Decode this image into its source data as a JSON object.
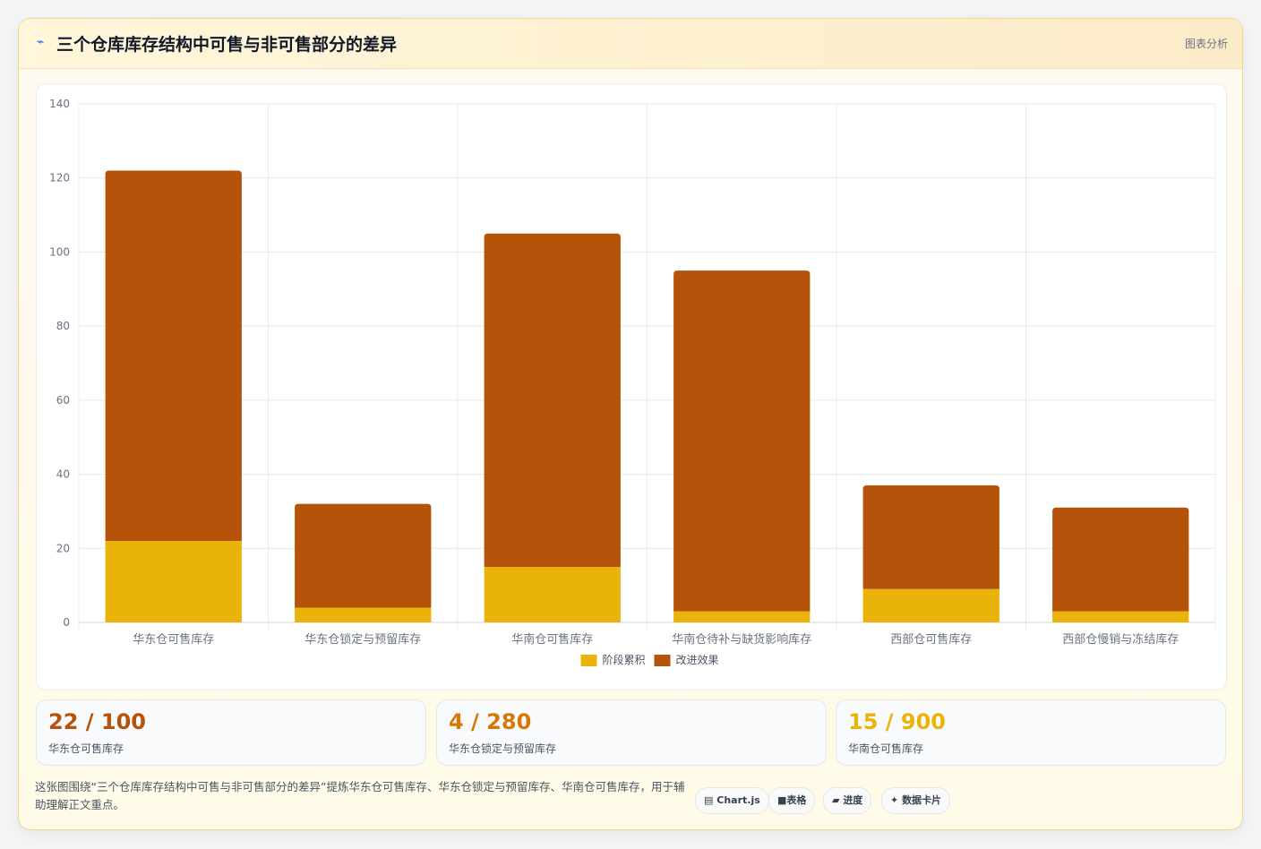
{
  "header": {
    "icon": "chart-icon",
    "title": "三个仓库库存结构中可售与非可售部分的差异",
    "tag": "图表分析"
  },
  "chart_data": {
    "type": "bar",
    "stacked": true,
    "categories": [
      "华东仓可售库存",
      "华东仓锁定与预留库存",
      "华南仓可售库存",
      "华南仓待补与缺货影响库存",
      "西部仓可售库存",
      "西部仓慢销与冻结库存"
    ],
    "series": [
      {
        "name": "阶段累积",
        "color": "#eab30a",
        "values": [
          22,
          4,
          15,
          3,
          9,
          3
        ]
      },
      {
        "name": "改进效果",
        "color": "#b45309",
        "values": [
          100,
          28,
          90,
          92,
          28,
          28
        ]
      }
    ],
    "ylim": [
      0,
      140
    ],
    "yticks": [
      0,
      20,
      40,
      60,
      80,
      100,
      120,
      140
    ],
    "grid": true,
    "legend_position": "bottom"
  },
  "stats": [
    {
      "value": "22 / 100",
      "label": "华东仓可售库存",
      "color": "#b45309"
    },
    {
      "value": "4 / 280",
      "label": "华东仓锁定与预留库存",
      "color": "#d97706"
    },
    {
      "value": "15 / 900",
      "label": "华南仓可售库存",
      "color": "#eab30a"
    }
  ],
  "footer": {
    "note": "这张图围绕“三个仓库库存结构中可售与非可售部分的差异”提炼华东仓可售库存、华东仓锁定与预留库存、华南仓可售库存，用于辅助理解正文重点。",
    "chips": [
      {
        "icon": "chart-icon",
        "glyph": "▤",
        "label": "Chart.js"
      },
      {
        "icon": "table-icon",
        "glyph": "■",
        "label": "表格"
      },
      {
        "icon": "progress-icon",
        "glyph": "▰",
        "label": "进度"
      },
      {
        "icon": "sparkle-icon",
        "glyph": "✦",
        "label": "数据卡片"
      }
    ]
  }
}
